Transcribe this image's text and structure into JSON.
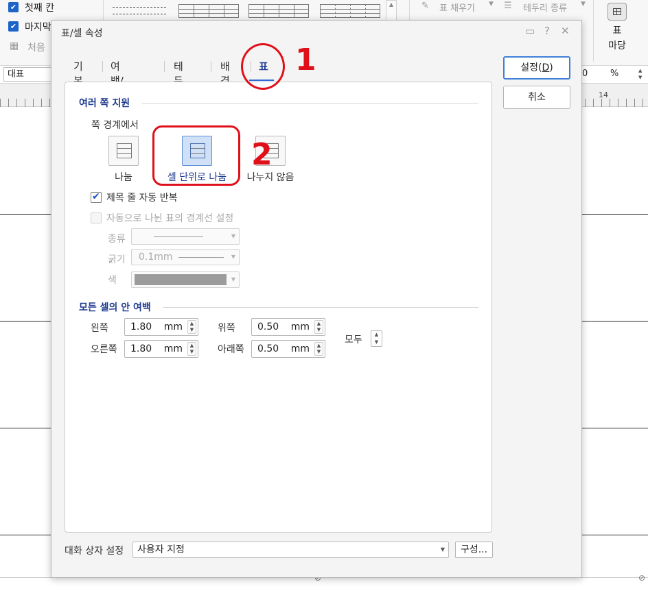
{
  "ribbon": {
    "check1_label": "첫째 칸",
    "check2_label": "마지막",
    "item3_label": "처음",
    "fill_label": "표 채우기",
    "border_type_label": "테두리 종류",
    "big_button_line1": "표",
    "big_button_line2": "마당"
  },
  "toolbar": {
    "style_combo": "대표",
    "percent_value": "0",
    "percent_unit": "%"
  },
  "ruler": {
    "mark_14": "14"
  },
  "dialog": {
    "title": "표/셀 속성",
    "tabs": [
      "기본",
      "여백/캡션",
      "테두리",
      "배경",
      "표"
    ],
    "active_tab_index": 4,
    "ok_label": "설정(",
    "ok_accel": "D",
    "ok_label_end": ")",
    "cancel_label": "취소",
    "section1_title": "여러 쪽 지원",
    "page_boundary_label": "쪽 경계에서",
    "options": [
      {
        "label": "나눔",
        "selected": false
      },
      {
        "label": "셀 단위로 나눔",
        "selected": true
      },
      {
        "label": "나누지 않음",
        "selected": false
      }
    ],
    "repeat_header_label": "제목 줄 자동 반복",
    "repeat_header_checked": true,
    "auto_split_border_label": "자동으로 나뉜 표의 경계선 설정",
    "auto_split_border_checked": false,
    "type_label": "종류",
    "thickness_label": "굵기",
    "thickness_value": "0.1mm",
    "color_label": "색",
    "color_value": "#9c9c9c",
    "section2_title": "모든 셀의 안 여백",
    "margins": {
      "left_label": "왼쪽",
      "left_value": "1.80",
      "left_unit": "mm",
      "right_label": "오른쪽",
      "right_value": "1.80",
      "right_unit": "mm",
      "top_label": "위쪽",
      "top_value": "0.50",
      "top_unit": "mm",
      "bottom_label": "아래쪽",
      "bottom_value": "0.50",
      "bottom_unit": "mm",
      "all_label": "모두"
    },
    "dialog_setting_label": "대화 상자 설정",
    "dialog_setting_value": "사용자 지정",
    "configure_label": "구성..."
  },
  "annotations": {
    "step1": "1",
    "step2": "2",
    "color": "#e0101a"
  }
}
